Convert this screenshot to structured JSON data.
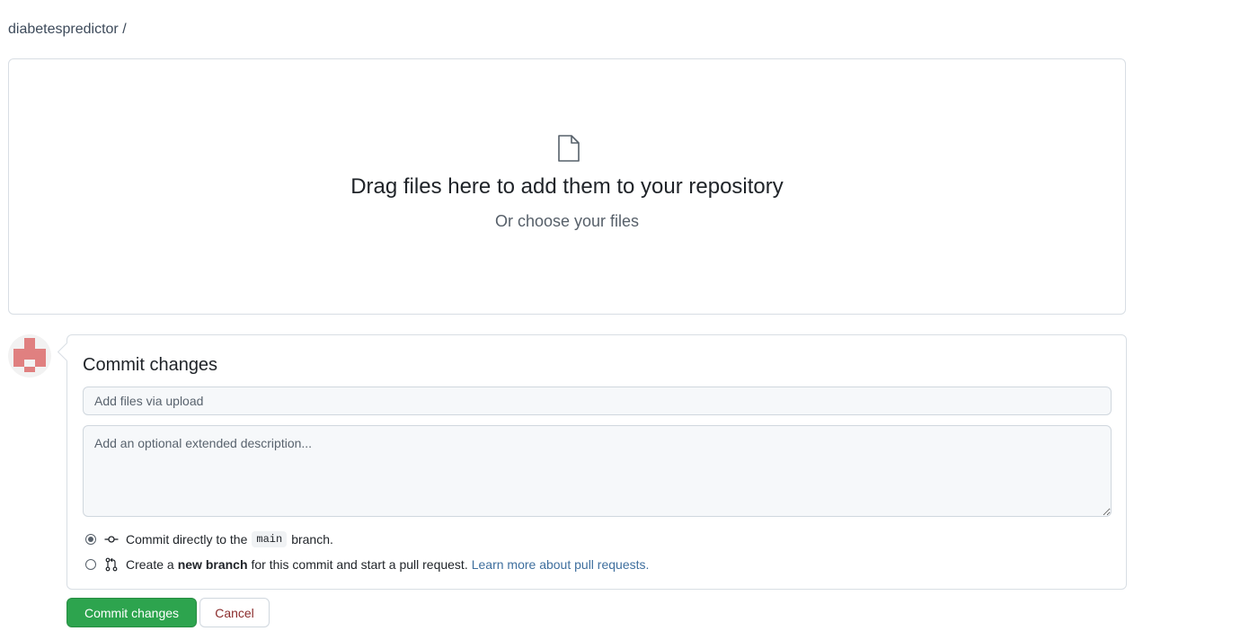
{
  "breadcrumb": {
    "repo": "diabetespredictor /"
  },
  "dropzone": {
    "icon": "file-icon",
    "title": "Drag files here to add them to your repository",
    "subtitle": "Or choose your files"
  },
  "commit": {
    "avatar": "avatar-identicon",
    "title": "Commit changes",
    "summary_placeholder": "Add files via upload",
    "description_placeholder": "Add an optional extended description...",
    "option_direct": {
      "icon": "git-commit-icon",
      "before": "Commit directly to the",
      "branch": "main",
      "after": "branch.",
      "selected": true
    },
    "option_new_branch": {
      "icon": "git-pull-request-icon",
      "before": "Create a",
      "bold": "new branch",
      "after": "for this commit and start a pull request.",
      "link": "Learn more about pull requests.",
      "selected": false
    }
  },
  "actions": {
    "commit_label": "Commit changes",
    "cancel_label": "Cancel"
  },
  "colors": {
    "primary_button": "#2da44e",
    "link": "#3f6f9e",
    "avatar": "#e08080"
  }
}
